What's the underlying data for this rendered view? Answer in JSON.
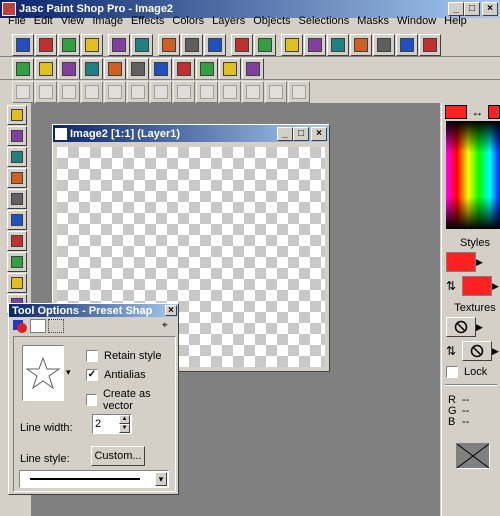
{
  "app": {
    "title": "Jasc Paint Shop Pro - Image2",
    "caption_buttons": [
      "_",
      "□",
      "×"
    ]
  },
  "menu": [
    "File",
    "Edit",
    "View",
    "Image",
    "Effects",
    "Colors",
    "Layers",
    "Objects",
    "Selections",
    "Masks",
    "Window",
    "Help"
  ],
  "toolbar1": [
    "new-icon",
    "open-icon",
    "save-icon",
    "print-icon",
    "undo-icon",
    "redo-icon",
    "cut-icon",
    "copy-icon",
    "paste-icon",
    "browse-icon",
    "stop-icon",
    "zoom-icon",
    "toolbar-toggle-icon",
    "histogram-icon",
    "overview-icon",
    "layers-palette-icon",
    "help-icon",
    "capture-icon"
  ],
  "toolbar2": [
    "lighting-icon",
    "frame-icon",
    "drop-shadow-icon",
    "effect-red-icon",
    "effect-lens-icon",
    "effect-spiral-icon",
    "effect-tile-icon",
    "effect-stamp-icon",
    "effect-tree-icon",
    "effect-blue-icon",
    "effect-wave-icon"
  ],
  "toolbar3": [
    "tool-a-icon",
    "tool-b-icon",
    "tool-c-icon",
    "tool-d-icon",
    "tool-e-icon",
    "tool-f-icon",
    "tool-g-icon",
    "tool-h-icon",
    "tool-i-icon",
    "tool-j-icon",
    "tool-k-icon",
    "tool-l-icon",
    "tool-m-icon"
  ],
  "tools": [
    "arrow-icon",
    "zoom-icon",
    "deform-icon",
    "crop-icon",
    "mover-icon",
    "selection-icon",
    "freehand-icon",
    "dropper-icon",
    "paintbrush-icon",
    "clone-icon"
  ],
  "image_window": {
    "title": "Image2 [1:1] (Layer1)",
    "caption_buttons": [
      "_",
      "□",
      "×"
    ]
  },
  "tool_options": {
    "title": "Tool Options - Preset Shap",
    "close": "×",
    "retain_style": {
      "label": "Retain style",
      "checked": false
    },
    "antialias": {
      "label": "Antialias",
      "checked": true,
      "mark": "✓"
    },
    "create_vector": {
      "label": "Create as vector",
      "checked": false
    },
    "line_width_label": "Line width:",
    "line_width_value": "2",
    "line_style_label": "Line style:",
    "custom_button": "Custom...",
    "dropdown_arrow": "▾"
  },
  "color_palette": {
    "styles_label": "Styles",
    "textures_label": "Textures",
    "lock_label": "Lock",
    "rgb": [
      {
        "channel": "R",
        "value": "--"
      },
      {
        "channel": "G",
        "value": "--"
      },
      {
        "channel": "B",
        "value": "--"
      }
    ],
    "swap_icon": "↔",
    "fg_color": "#ff2020",
    "bg_color": "#ff2020"
  }
}
